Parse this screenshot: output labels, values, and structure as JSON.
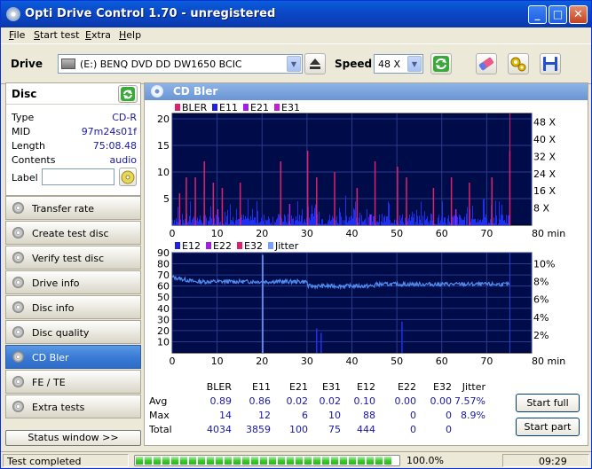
{
  "window": {
    "title": "Opti Drive Control 1.70 - unregistered"
  },
  "menu": [
    {
      "u": "F",
      "rest": "ile"
    },
    {
      "u": "S",
      "rest": "tart test"
    },
    {
      "u": "E",
      "rest": "xtra"
    },
    {
      "u": "H",
      "rest": "elp"
    }
  ],
  "toolbar": {
    "drive_label": "Drive",
    "drive_value": "(E:)  BENQ DVD DD DW1650 BCIC",
    "speed_label": "Speed",
    "speed_value": "48 X"
  },
  "disc": {
    "header": "Disc",
    "type_k": "Type",
    "type_v": "CD-R",
    "mid_k": "MID",
    "mid_v": "97m24s01f",
    "length_k": "Length",
    "length_v": "75:08.48",
    "contents_k": "Contents",
    "contents_v": "audio",
    "label_k": "Label",
    "label_v": ""
  },
  "nav": [
    "Transfer rate",
    "Create test disc",
    "Verify test disc",
    "Drive info",
    "Disc info",
    "Disc quality",
    "CD Bler",
    "FE / TE",
    "Extra tests"
  ],
  "nav_active": "CD Bler",
  "status_window_btn": "Status window >>",
  "panel": {
    "title": "CD Bler"
  },
  "chart1": {
    "legend": [
      {
        "name": "BLER",
        "color": "#e0206a"
      },
      {
        "name": "E11",
        "color": "#1f1fe6"
      },
      {
        "name": "E21",
        "color": "#a020e0"
      },
      {
        "name": "E31",
        "color": "#c020d0"
      }
    ],
    "y_ticks": [
      "20",
      "15",
      "10",
      "5"
    ],
    "y2_ticks": [
      "48 X",
      "40 X",
      "32 X",
      "24 X",
      "16 X",
      "8 X"
    ],
    "x_ticks": [
      "0",
      "10",
      "20",
      "30",
      "40",
      "50",
      "60",
      "70",
      "80 min"
    ]
  },
  "chart2": {
    "legend": [
      {
        "name": "E12",
        "color": "#1f1fe6"
      },
      {
        "name": "E22",
        "color": "#a020e0"
      },
      {
        "name": "E32",
        "color": "#e0206a"
      },
      {
        "name": "Jitter",
        "color": "#7aa0ff"
      }
    ],
    "y_ticks": [
      "90",
      "80",
      "70",
      "60",
      "50",
      "40",
      "30",
      "20",
      "10"
    ],
    "y2_ticks": [
      "10%",
      "8%",
      "6%",
      "4%",
      "2%"
    ],
    "x_ticks": [
      "0",
      "10",
      "20",
      "30",
      "40",
      "50",
      "60",
      "70",
      "80 min"
    ]
  },
  "chart_data": [
    {
      "type": "bar",
      "series": [
        {
          "name": "BLER",
          "max": 14,
          "avg": 0.89,
          "total": 4034
        },
        {
          "name": "E11",
          "max": 12,
          "avg": 0.86,
          "total": 3859
        },
        {
          "name": "E21",
          "max": 6,
          "avg": 0.02,
          "total": 100
        },
        {
          "name": "E31",
          "max": 10,
          "avg": 0.02,
          "total": 75
        }
      ],
      "xlim": [
        0,
        80
      ],
      "ylim": [
        0,
        20
      ],
      "xlabel": "min"
    },
    {
      "type": "line",
      "series": [
        {
          "name": "E12",
          "max": 88,
          "avg": 0.1,
          "total": 444
        },
        {
          "name": "E22",
          "max": 0,
          "avg": 0.0,
          "total": 0
        },
        {
          "name": "E32",
          "max": 0,
          "avg": 0.0,
          "total": 0
        },
        {
          "name": "Jitter",
          "max": "8.9%",
          "avg": "7.57%"
        }
      ],
      "xlim": [
        0,
        80
      ],
      "ylim": [
        0,
        90
      ],
      "xlabel": "min"
    }
  ],
  "stats": {
    "headers": [
      "BLER",
      "E11",
      "E21",
      "E31",
      "E12",
      "E22",
      "E32",
      "Jitter"
    ],
    "rows": [
      {
        "label": "Avg",
        "vals": [
          "0.89",
          "0.86",
          "0.02",
          "0.02",
          "0.10",
          "0.00",
          "0.00",
          "7.57%"
        ]
      },
      {
        "label": "Max",
        "vals": [
          "14",
          "12",
          "6",
          "10",
          "88",
          "0",
          "0",
          "8.9%"
        ]
      },
      {
        "label": "Total",
        "vals": [
          "4034",
          "3859",
          "100",
          "75",
          "444",
          "0",
          "0",
          ""
        ]
      }
    ]
  },
  "buttons": {
    "start_full": "Start full",
    "start_part": "Start part"
  },
  "status": {
    "text": "Test completed",
    "progress": "100.0%",
    "progress_fraction": 1.0,
    "time": "09:29"
  }
}
